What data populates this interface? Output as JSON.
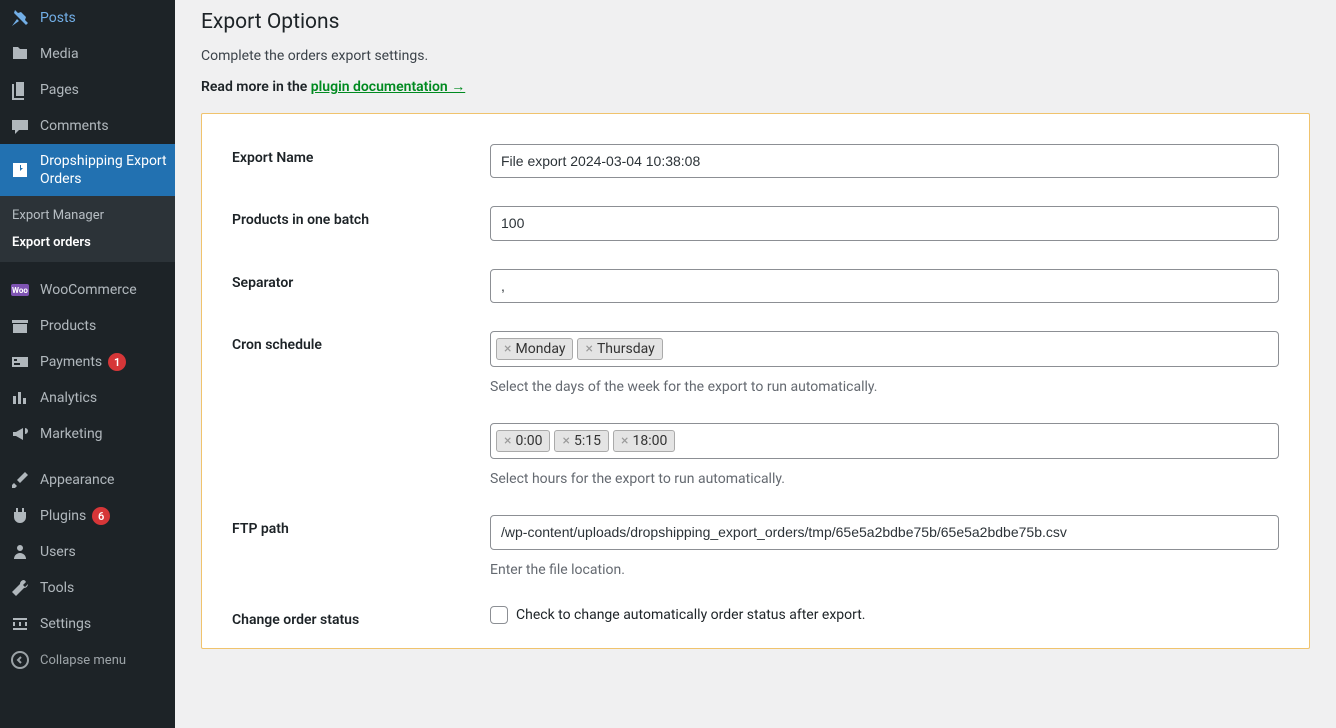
{
  "sidebar": {
    "items": [
      {
        "label": "Posts",
        "icon": "pin"
      },
      {
        "label": "Media",
        "icon": "media"
      },
      {
        "label": "Pages",
        "icon": "pages"
      },
      {
        "label": "Comments",
        "icon": "comment"
      },
      {
        "label": "Dropshipping Export Orders",
        "icon": "export",
        "active": true
      },
      {
        "label": "WooCommerce",
        "icon": "woo"
      },
      {
        "label": "Products",
        "icon": "archive"
      },
      {
        "label": "Payments",
        "icon": "payments",
        "badge": "1"
      },
      {
        "label": "Analytics",
        "icon": "analytics"
      },
      {
        "label": "Marketing",
        "icon": "megaphone"
      },
      {
        "label": "Appearance",
        "icon": "brush"
      },
      {
        "label": "Plugins",
        "icon": "plugin",
        "badge": "6"
      },
      {
        "label": "Users",
        "icon": "users"
      },
      {
        "label": "Tools",
        "icon": "tools"
      },
      {
        "label": "Settings",
        "icon": "settings"
      }
    ],
    "submenu": [
      {
        "label": "Export Manager"
      },
      {
        "label": "Export orders",
        "current": true
      }
    ],
    "collapse": "Collapse menu"
  },
  "page": {
    "title": "Export Options",
    "subtitle": "Complete the orders export settings.",
    "readmore_prefix": "Read more in the ",
    "readmore_link": "plugin documentation →"
  },
  "form": {
    "export_name": {
      "label": "Export Name",
      "value": "File export 2024-03-04 10:38:08"
    },
    "batch": {
      "label": "Products in one batch",
      "value": "100"
    },
    "separator": {
      "label": "Separator",
      "value": ","
    },
    "cron": {
      "label": "Cron schedule",
      "days": [
        "Monday",
        "Thursday"
      ],
      "days_help": "Select the days of the week for the export to run automatically.",
      "hours": [
        "0:00",
        "5:15",
        "18:00"
      ],
      "hours_help": "Select hours for the export to run automatically."
    },
    "ftp": {
      "label": "FTP path",
      "value": "/wp-content/uploads/dropshipping_export_orders/tmp/65e5a2bdbe75b/65e5a2bdbe75b.csv",
      "help": "Enter the file location."
    },
    "change_status": {
      "label": "Change order status",
      "checkbox_label": "Check to change automatically order status after export."
    }
  }
}
